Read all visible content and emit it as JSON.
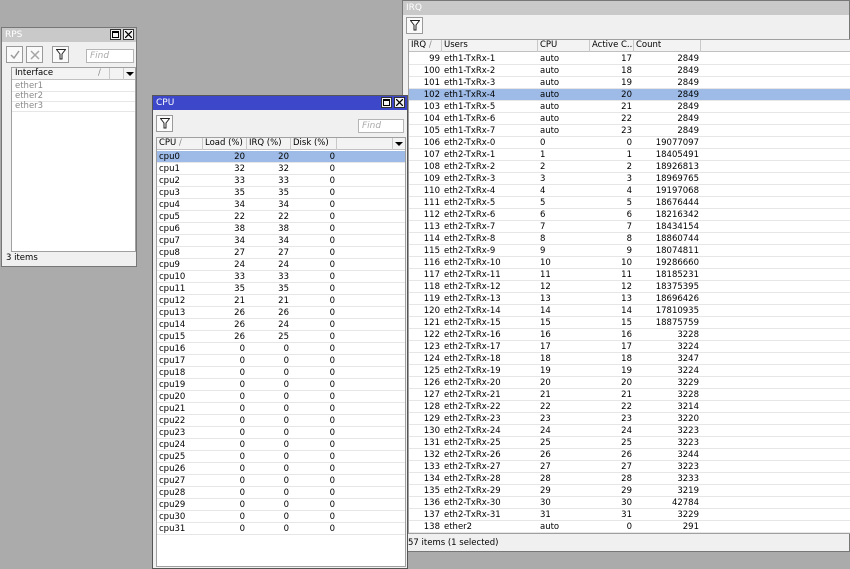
{
  "rps": {
    "title": "RPS",
    "find_placeholder": "Find",
    "columns": [
      "Interface"
    ],
    "rows": [
      "ether1",
      "ether2",
      "ether3"
    ],
    "status": "3 items"
  },
  "cpu": {
    "title": "CPU",
    "find_placeholder": "Find",
    "columns": [
      "CPU",
      "Load (%)",
      "IRQ (%)",
      "Disk (%)"
    ],
    "selected_index": 0,
    "rows": [
      [
        "cpu0",
        "20",
        "20",
        "0"
      ],
      [
        "cpu1",
        "32",
        "32",
        "0"
      ],
      [
        "cpu2",
        "33",
        "33",
        "0"
      ],
      [
        "cpu3",
        "35",
        "35",
        "0"
      ],
      [
        "cpu4",
        "34",
        "34",
        "0"
      ],
      [
        "cpu5",
        "22",
        "22",
        "0"
      ],
      [
        "cpu6",
        "38",
        "38",
        "0"
      ],
      [
        "cpu7",
        "34",
        "34",
        "0"
      ],
      [
        "cpu8",
        "27",
        "27",
        "0"
      ],
      [
        "cpu9",
        "24",
        "24",
        "0"
      ],
      [
        "cpu10",
        "33",
        "33",
        "0"
      ],
      [
        "cpu11",
        "35",
        "35",
        "0"
      ],
      [
        "cpu12",
        "21",
        "21",
        "0"
      ],
      [
        "cpu13",
        "26",
        "26",
        "0"
      ],
      [
        "cpu14",
        "26",
        "24",
        "0"
      ],
      [
        "cpu15",
        "26",
        "25",
        "0"
      ],
      [
        "cpu16",
        "0",
        "0",
        "0"
      ],
      [
        "cpu17",
        "0",
        "0",
        "0"
      ],
      [
        "cpu18",
        "0",
        "0",
        "0"
      ],
      [
        "cpu19",
        "0",
        "0",
        "0"
      ],
      [
        "cpu20",
        "0",
        "0",
        "0"
      ],
      [
        "cpu21",
        "0",
        "0",
        "0"
      ],
      [
        "cpu22",
        "0",
        "0",
        "0"
      ],
      [
        "cpu23",
        "0",
        "0",
        "0"
      ],
      [
        "cpu24",
        "0",
        "0",
        "0"
      ],
      [
        "cpu25",
        "0",
        "0",
        "0"
      ],
      [
        "cpu26",
        "0",
        "0",
        "0"
      ],
      [
        "cpu27",
        "0",
        "0",
        "0"
      ],
      [
        "cpu28",
        "0",
        "0",
        "0"
      ],
      [
        "cpu29",
        "0",
        "0",
        "0"
      ],
      [
        "cpu30",
        "0",
        "0",
        "0"
      ],
      [
        "cpu31",
        "0",
        "0",
        "0"
      ]
    ]
  },
  "irq": {
    "title": "IRQ",
    "columns": [
      "IRQ",
      "Users",
      "CPU",
      "Active C...",
      "Count"
    ],
    "selected_index": 3,
    "rows": [
      [
        "99",
        "eth1-TxRx-1",
        "auto",
        "17",
        "2849"
      ],
      [
        "100",
        "eth1-TxRx-2",
        "auto",
        "18",
        "2849"
      ],
      [
        "101",
        "eth1-TxRx-3",
        "auto",
        "19",
        "2849"
      ],
      [
        "102",
        "eth1-TxRx-4",
        "auto",
        "20",
        "2849"
      ],
      [
        "103",
        "eth1-TxRx-5",
        "auto",
        "21",
        "2849"
      ],
      [
        "104",
        "eth1-TxRx-6",
        "auto",
        "22",
        "2849"
      ],
      [
        "105",
        "eth1-TxRx-7",
        "auto",
        "23",
        "2849"
      ],
      [
        "106",
        "eth2-TxRx-0",
        "0",
        "0",
        "19077097"
      ],
      [
        "107",
        "eth2-TxRx-1",
        "1",
        "1",
        "18405491"
      ],
      [
        "108",
        "eth2-TxRx-2",
        "2",
        "2",
        "18926813"
      ],
      [
        "109",
        "eth2-TxRx-3",
        "3",
        "3",
        "18969765"
      ],
      [
        "110",
        "eth2-TxRx-4",
        "4",
        "4",
        "19197068"
      ],
      [
        "111",
        "eth2-TxRx-5",
        "5",
        "5",
        "18676444"
      ],
      [
        "112",
        "eth2-TxRx-6",
        "6",
        "6",
        "18216342"
      ],
      [
        "113",
        "eth2-TxRx-7",
        "7",
        "7",
        "18434154"
      ],
      [
        "114",
        "eth2-TxRx-8",
        "8",
        "8",
        "18860744"
      ],
      [
        "115",
        "eth2-TxRx-9",
        "9",
        "9",
        "18074811"
      ],
      [
        "116",
        "eth2-TxRx-10",
        "10",
        "10",
        "19286660"
      ],
      [
        "117",
        "eth2-TxRx-11",
        "11",
        "11",
        "18185231"
      ],
      [
        "118",
        "eth2-TxRx-12",
        "12",
        "12",
        "18375395"
      ],
      [
        "119",
        "eth2-TxRx-13",
        "13",
        "13",
        "18696426"
      ],
      [
        "120",
        "eth2-TxRx-14",
        "14",
        "14",
        "17810935"
      ],
      [
        "121",
        "eth2-TxRx-15",
        "15",
        "15",
        "18875759"
      ],
      [
        "122",
        "eth2-TxRx-16",
        "16",
        "16",
        "3228"
      ],
      [
        "123",
        "eth2-TxRx-17",
        "17",
        "17",
        "3224"
      ],
      [
        "124",
        "eth2-TxRx-18",
        "18",
        "18",
        "3247"
      ],
      [
        "125",
        "eth2-TxRx-19",
        "19",
        "19",
        "3224"
      ],
      [
        "126",
        "eth2-TxRx-20",
        "20",
        "20",
        "3229"
      ],
      [
        "127",
        "eth2-TxRx-21",
        "21",
        "21",
        "3228"
      ],
      [
        "128",
        "eth2-TxRx-22",
        "22",
        "22",
        "3214"
      ],
      [
        "129",
        "eth2-TxRx-23",
        "23",
        "23",
        "3220"
      ],
      [
        "130",
        "eth2-TxRx-24",
        "24",
        "24",
        "3223"
      ],
      [
        "131",
        "eth2-TxRx-25",
        "25",
        "25",
        "3223"
      ],
      [
        "132",
        "eth2-TxRx-26",
        "26",
        "26",
        "3244"
      ],
      [
        "133",
        "eth2-TxRx-27",
        "27",
        "27",
        "3223"
      ],
      [
        "134",
        "eth2-TxRx-28",
        "28",
        "28",
        "3233"
      ],
      [
        "135",
        "eth2-TxRx-29",
        "29",
        "29",
        "3219"
      ],
      [
        "136",
        "eth2-TxRx-30",
        "30",
        "30",
        "42784"
      ],
      [
        "137",
        "eth2-TxRx-31",
        "31",
        "31",
        "3229"
      ],
      [
        "138",
        "ether2",
        "auto",
        "0",
        "291"
      ]
    ],
    "status": "57 items (1 selected)"
  },
  "icons": {
    "filter": "filter-icon",
    "enable": "check-icon",
    "disable": "cross-icon",
    "maximize": "maximize-icon",
    "close": "close-icon"
  }
}
